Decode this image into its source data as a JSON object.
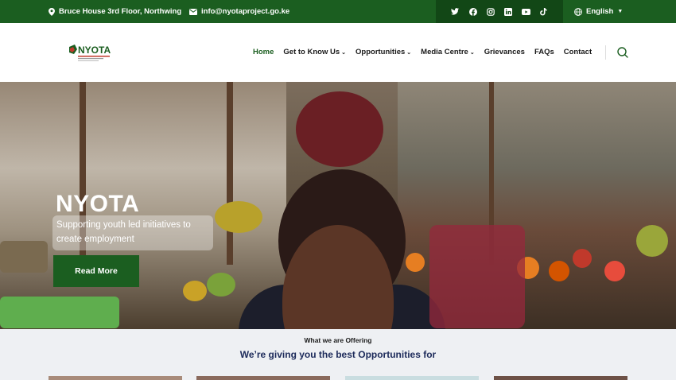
{
  "topbar": {
    "address": "Bruce House 3rd Floor, Northwing",
    "email": "info@nyotaproject.go.ke",
    "socials": [
      "twitter-icon",
      "facebook-icon",
      "instagram-icon",
      "linkedin-icon",
      "youtube-icon",
      "tiktok-icon"
    ],
    "language": "English"
  },
  "header": {
    "logo_text": "NYOTA",
    "nav": [
      "Home",
      "Get to Know Us",
      "Opportunities",
      "Media Centre",
      "Grievances",
      "FAQs",
      "Contact"
    ]
  },
  "hero": {
    "title": "NYOTA",
    "subtitle": "Supporting youth led initiatives to create employment",
    "button": "Read More"
  },
  "offer": {
    "tag": "What we are Offering",
    "heading": "We’re giving you the best Opportunities for"
  },
  "colors": {
    "brand_green": "#1b5e20",
    "dark_green": "#124716",
    "heading_navy": "#1c2a5a"
  }
}
